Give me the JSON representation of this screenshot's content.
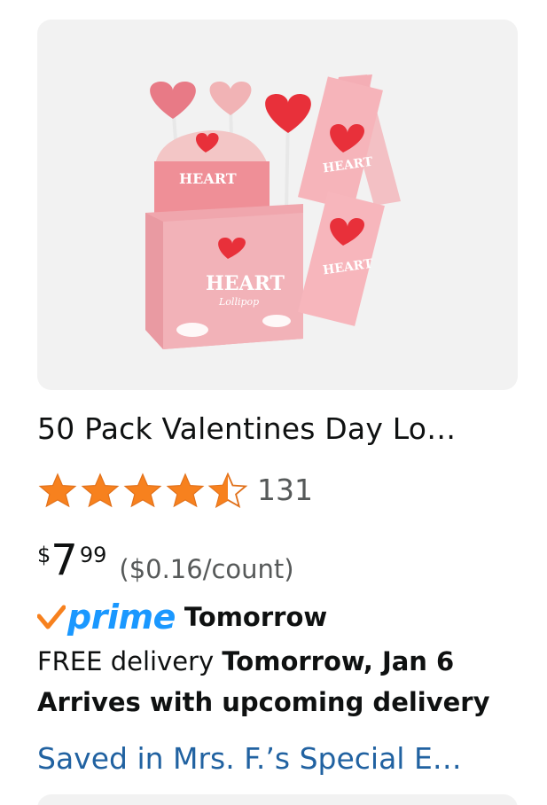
{
  "product": {
    "image_alt": "Heart lollipop box and packs",
    "image_texts": {
      "box_brand": "HEART",
      "box_sub": "Lollipop",
      "pack_brand": "HEART"
    },
    "title": "50 Pack Valentines Day Lo…",
    "rating": {
      "stars": 4.5,
      "max": 5,
      "count": "131",
      "star_color": "#f3a847",
      "star_fill": "#f7811e"
    },
    "price": {
      "symbol": "$",
      "whole": "7",
      "fraction": "99",
      "unit": "($0.16/count)"
    },
    "prime": {
      "word": "prime",
      "delivery_when": "Tomorrow",
      "accent": "#1a98ff",
      "check_color": "#f7811e"
    },
    "delivery": {
      "prefix": "FREE delivery ",
      "date": "Tomorrow, Jan 6"
    },
    "arrives": "Arrives with upcoming delivery",
    "saved_in": "Saved in Mrs. F.’s Special E…"
  }
}
